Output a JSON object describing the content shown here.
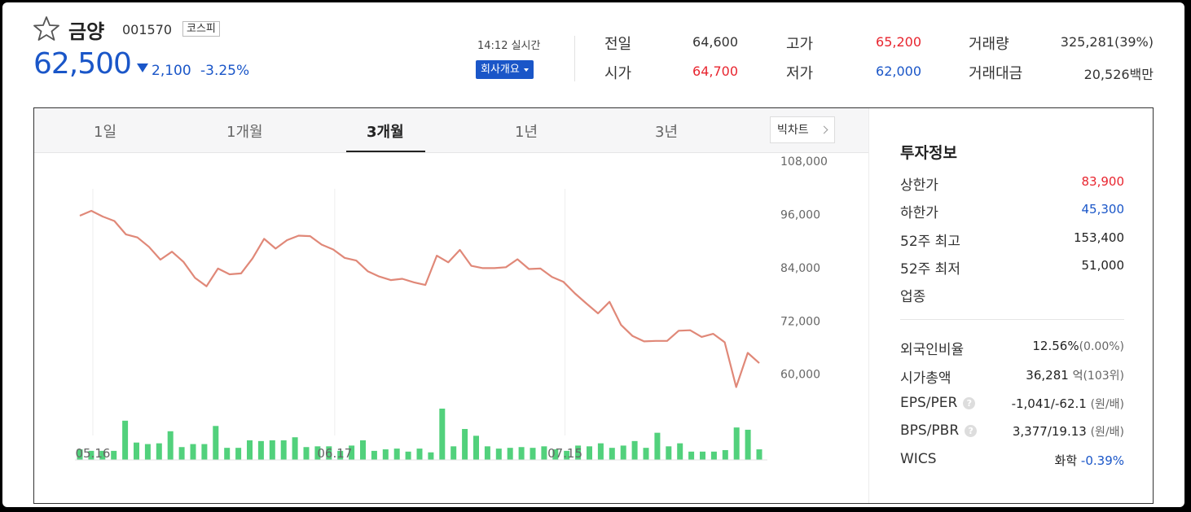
{
  "stock": {
    "name": "금양",
    "code": "001570",
    "market": "코스피",
    "price": "62,500",
    "change": "2,100",
    "change_pct": "-3.25%"
  },
  "realtime": {
    "time_label": "14:12 실시간",
    "company_button": "회사개요"
  },
  "quote": {
    "prev_close_label": "전일",
    "prev_close": "64,600",
    "open_label": "시가",
    "open": "64,700",
    "high_label": "고가",
    "high": "65,200",
    "low_label": "저가",
    "low": "62,000",
    "volume_label": "거래량",
    "volume": "325,281(39%)",
    "amount_label": "거래대금",
    "amount": "20,526백만"
  },
  "tabs": [
    "1일",
    "1개월",
    "3개월",
    "1년",
    "3년"
  ],
  "active_tab": "3개월",
  "big_chart_label": "빅차트",
  "info": {
    "title": "투자정보",
    "upper_limit_label": "상한가",
    "upper_limit": "83,900",
    "lower_limit_label": "하한가",
    "lower_limit": "45,300",
    "high52_label": "52주 최고",
    "high52": "153,400",
    "low52_label": "52주 최저",
    "low52": "51,000",
    "industry_label": "업종",
    "foreign_label": "외국인비율",
    "foreign_value": "12.56%",
    "foreign_change": "(0.00%)",
    "mcap_label": "시가총액",
    "mcap_value": "36,281",
    "mcap_unit": "억",
    "mcap_rank": "(103위)",
    "eps_label": "EPS/PER",
    "eps_value": "-1,041/-62.1",
    "eps_unit": "(원/배)",
    "bps_label": "BPS/PBR",
    "bps_value": "3,377/19.13",
    "bps_unit": "(원/배)",
    "wics_label": "WICS",
    "wics_value": "화학",
    "wics_change": "-0.39%"
  },
  "colors": {
    "up": "#e8252f",
    "down": "#1a56c8",
    "line": "#e08878",
    "volume": "#52d17c"
  },
  "chart_data": {
    "type": "line",
    "y_ticks": [
      "108,000",
      "96,000",
      "84,000",
      "72,000",
      "60,000"
    ],
    "y_tick_values": [
      108000,
      96000,
      84000,
      72000,
      60000
    ],
    "x_tick_labels": [
      "05.16",
      "06.17",
      "07.15"
    ],
    "x_tick_index": [
      0,
      21,
      41
    ],
    "ylim": [
      55000,
      110000
    ],
    "price": [
      95700,
      96800,
      95500,
      94500,
      91500,
      90800,
      88700,
      85800,
      87600,
      85300,
      81700,
      79800,
      83800,
      82500,
      82700,
      86100,
      90500,
      88300,
      90200,
      91200,
      91100,
      89200,
      88100,
      86200,
      85600,
      83200,
      82000,
      81200,
      81500,
      80700,
      80100,
      86700,
      85200,
      88000,
      84400,
      83900,
      83900,
      84100,
      85900,
      83700,
      83800,
      81900,
      80800,
      78200,
      75900,
      73700,
      76300,
      71100,
      68600,
      67400,
      67500,
      67500,
      69800,
      69900,
      68400,
      69100,
      67200,
      57100,
      64800,
      62500
    ],
    "volume": [
      14,
      12,
      12,
      12,
      52,
      23,
      21,
      22,
      38,
      17,
      21,
      21,
      45,
      16,
      16,
      26,
      25,
      26,
      26,
      30,
      17,
      18,
      18,
      12,
      19,
      26,
      12,
      14,
      15,
      11,
      15,
      10,
      68,
      18,
      41,
      32,
      18,
      15,
      16,
      17,
      16,
      18,
      14,
      12,
      19,
      18,
      22,
      16,
      19,
      25,
      16,
      36,
      18,
      22,
      11,
      11,
      11,
      13,
      43,
      40,
      14
    ]
  }
}
